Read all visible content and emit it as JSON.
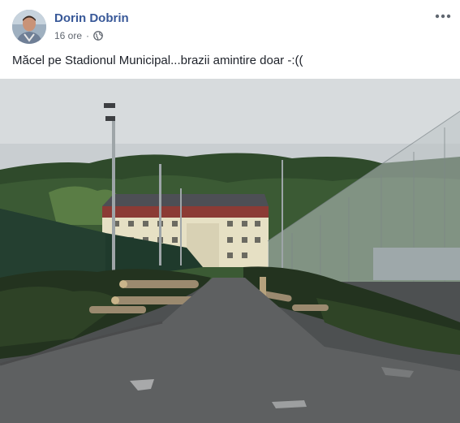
{
  "post": {
    "author_name": "Dorin Dobrin",
    "timestamp": "16 ore",
    "privacy_icon": "globe-icon",
    "more_icon": "more-options-icon",
    "caption": "Măcel pe Stadionul Municipal...brazii amintire doar -:(("
  },
  "colors": {
    "author_link": "#385898",
    "meta_text": "#616770",
    "body_text": "#1d2129"
  }
}
